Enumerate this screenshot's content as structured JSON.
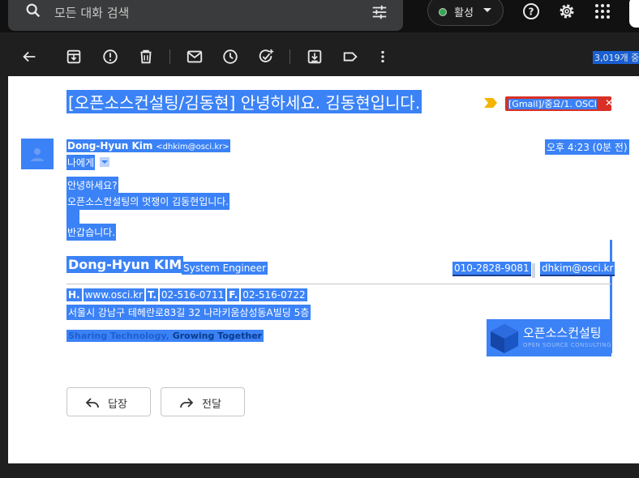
{
  "search": {
    "placeholder": "모든 대화 검색"
  },
  "status": {
    "label": "활성"
  },
  "toolbar": {
    "count_label": "3,019개 중"
  },
  "email": {
    "subject": "[오픈소스컨설팅/김동현] 안녕하세요. 김동현입니다.",
    "label": "[Gmail]/중요/1. OSCI",
    "sender_name": "Dong-Hyun Kim",
    "sender_email": "<dhkim@osci.kr>",
    "time": "오후 4:23 (0분 전)",
    "to": "나에게",
    "body": [
      "안녕하세요?",
      "오픈소스컨설팅의 멋쟁이 김동현입니다.",
      "반갑습니다."
    ],
    "signature": {
      "name": "Dong-Hyun KIM",
      "title": "System Engineer",
      "phone": "010-2828-9081",
      "email": "dhkim@osci.kr",
      "h_label": "H.",
      "website": "www.osci.kr",
      "t_label": "T.",
      "tel": "02-516-0711",
      "f_label": "F.",
      "fax": "02-516-0722",
      "address": "서울시 강남구 테헤란로83길 32 나라키움삼성동A빌딩 5층",
      "tagline_part1": "Sharing Technology,",
      "tagline_part2": "Growing Together",
      "logo_text": "오픈소스컨설팅",
      "logo_sub": "OPEN SOURCE CONSULTING"
    }
  },
  "actions": {
    "reply": "답장",
    "forward": "전달"
  },
  "colors": {
    "highlight": "#3b82f6",
    "label_red": "#d93025",
    "status_green": "#34a853"
  }
}
